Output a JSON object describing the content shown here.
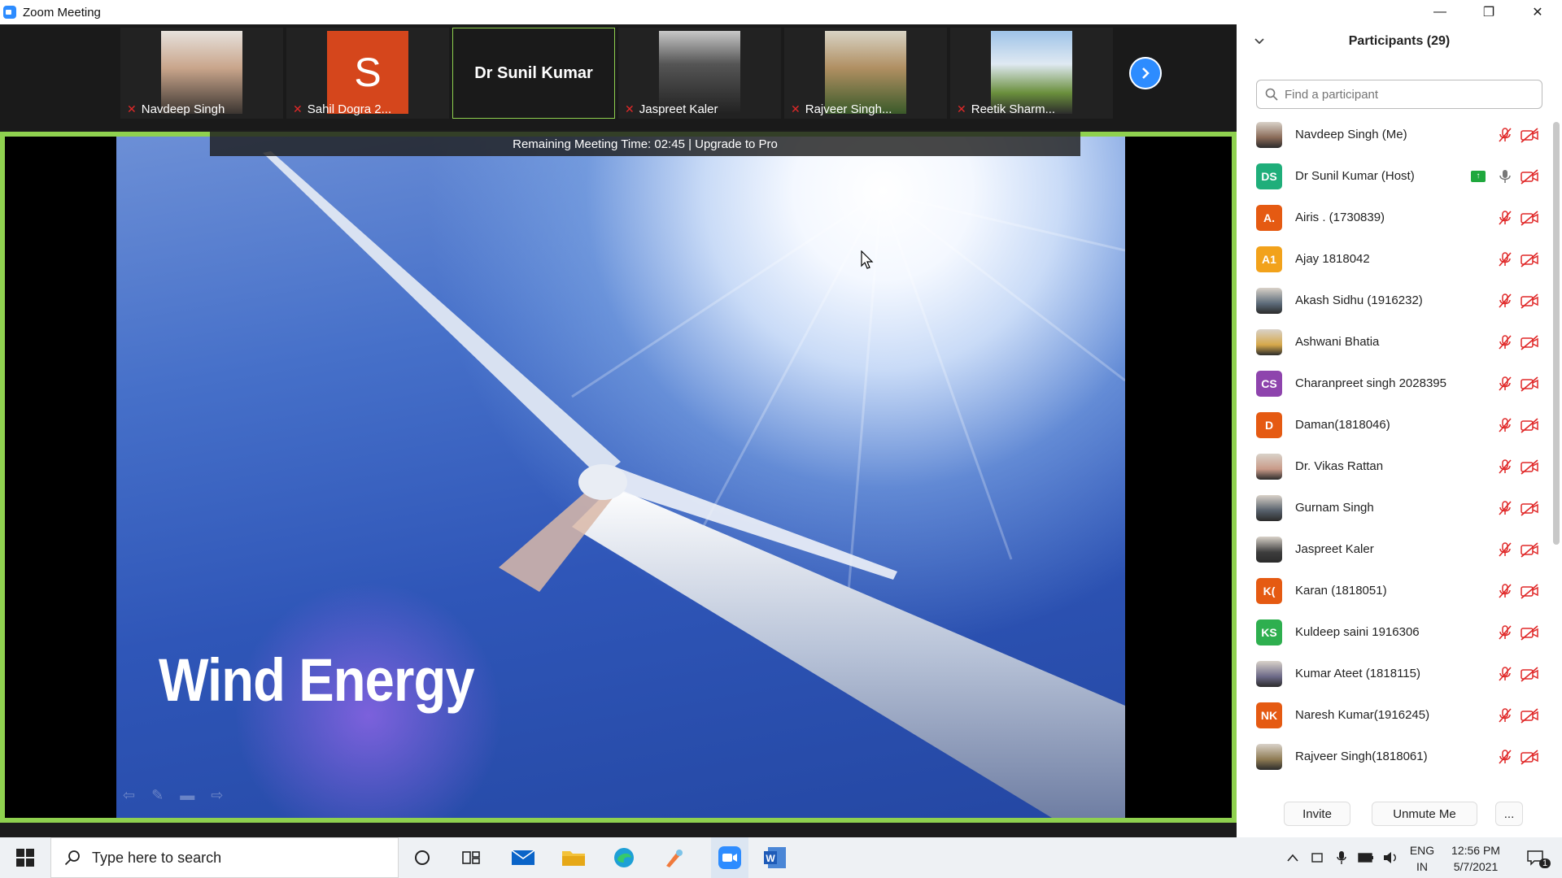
{
  "window": {
    "title": "Zoom Meeting",
    "min": "—",
    "restore": "❐",
    "close": "✕"
  },
  "thumbnails": [
    {
      "name": "Navdeep Singh",
      "color": "#b58f79"
    },
    {
      "name": "Sahil Dogra 2...",
      "initial": "S",
      "color": "#d5461c"
    },
    {
      "name": "Dr Sunil Kumar",
      "active": true
    },
    {
      "name": "Jaspreet Kaler",
      "color": "#4a4a4a"
    },
    {
      "name": "Rajveer Singh...",
      "color": "#8e7b53"
    },
    {
      "name": "Reetik Sharm...",
      "color": "#6a8f3c"
    }
  ],
  "meeting": {
    "timer_text": "Remaining Meeting Time: 02:45 | Upgrade to Pro",
    "slide_title": "Wind Energy"
  },
  "panel": {
    "title": "Participants (29)",
    "search_placeholder": "Find a participant",
    "participants": [
      {
        "name": "Navdeep Singh (Me)",
        "avatar": "photo",
        "color": "#8a6b58"
      },
      {
        "name": "Dr Sunil Kumar (Host)",
        "avatar": "DS",
        "color": "#1fae7a",
        "host": true
      },
      {
        "name": "Airis . (1730839)",
        "avatar": "A.",
        "color": "#e55a12"
      },
      {
        "name": "Ajay 1818042",
        "avatar": "A1",
        "color": "#f2a21b"
      },
      {
        "name": "Akash Sidhu (1916232)",
        "avatar": "photo",
        "color": "#5d6c7a"
      },
      {
        "name": "Ashwani Bhatia",
        "avatar": "photo",
        "color": "#d6a84a"
      },
      {
        "name": "Charanpreet singh 2028395",
        "avatar": "CS",
        "color": "#8e44ad"
      },
      {
        "name": "Daman(1818046)",
        "avatar": "D",
        "color": "#e55a12"
      },
      {
        "name": "Dr. Vikas Rattan",
        "avatar": "photo",
        "color": "#c99a88"
      },
      {
        "name": "Gurnam Singh",
        "avatar": "photo",
        "color": "#56606b"
      },
      {
        "name": "Jaspreet Kaler",
        "avatar": "photo",
        "color": "#3e3e3e"
      },
      {
        "name": "Karan (1818051)",
        "avatar": "K(",
        "color": "#e55a12"
      },
      {
        "name": "Kuldeep saini 1916306",
        "avatar": "KS",
        "color": "#2eaf4f"
      },
      {
        "name": "Kumar Ateet (1818115)",
        "avatar": "photo",
        "color": "#6d6a88"
      },
      {
        "name": "Naresh Kumar(1916245)",
        "avatar": "NK",
        "color": "#e55a12"
      },
      {
        "name": "Rajveer Singh(1818061)",
        "avatar": "photo",
        "color": "#8e7b53"
      }
    ],
    "footer": {
      "invite": "Invite",
      "unmute": "Unmute Me",
      "more": "..."
    }
  },
  "taskbar": {
    "search_placeholder": "Type here to search",
    "lang_line1": "ENG",
    "lang_line2": "IN",
    "time": "12:56 PM",
    "date": "5/7/2021",
    "notif_count": "1"
  }
}
